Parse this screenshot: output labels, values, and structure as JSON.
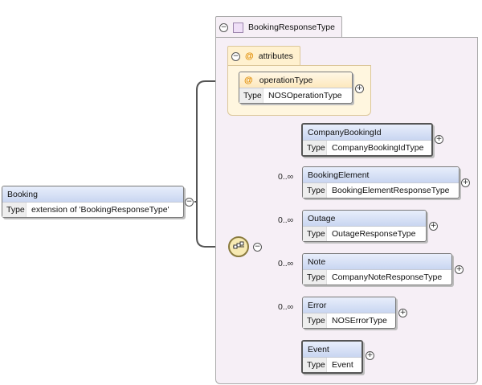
{
  "root": {
    "name": "Booking",
    "type_label": "Type",
    "type_value": "extension of 'BookingResponseType'"
  },
  "complex_type": {
    "name": "BookingResponseType"
  },
  "attributes": {
    "label": "attributes",
    "items": [
      {
        "name": "operationType",
        "type_label": "Type",
        "type_value": "NOSOperationType"
      }
    ]
  },
  "sequence": {
    "icon": "sequence-compositor-icon",
    "elements": [
      {
        "name": "CompanyBookingId",
        "type_label": "Type",
        "type_value": "CompanyBookingIdType",
        "multiplicity": ""
      },
      {
        "name": "BookingElement",
        "type_label": "Type",
        "type_value": "BookingElementResponseType",
        "multiplicity": "0..∞"
      },
      {
        "name": "Outage",
        "type_label": "Type",
        "type_value": "OutageResponseType",
        "multiplicity": "0..∞"
      },
      {
        "name": "Note",
        "type_label": "Type",
        "type_value": "CompanyNoteResponseType",
        "multiplicity": "0..∞"
      },
      {
        "name": "Error",
        "type_label": "Type",
        "type_value": "NOSErrorType",
        "multiplicity": "0..∞"
      },
      {
        "name": "Event",
        "type_label": "Type",
        "type_value": "Event",
        "multiplicity": ""
      }
    ]
  },
  "colors": {
    "complex_type_bg": "#f6eff6",
    "attribute_bg": "#fff6df",
    "element_header": "#c9d6f1",
    "compositor": "#f7eab3"
  }
}
